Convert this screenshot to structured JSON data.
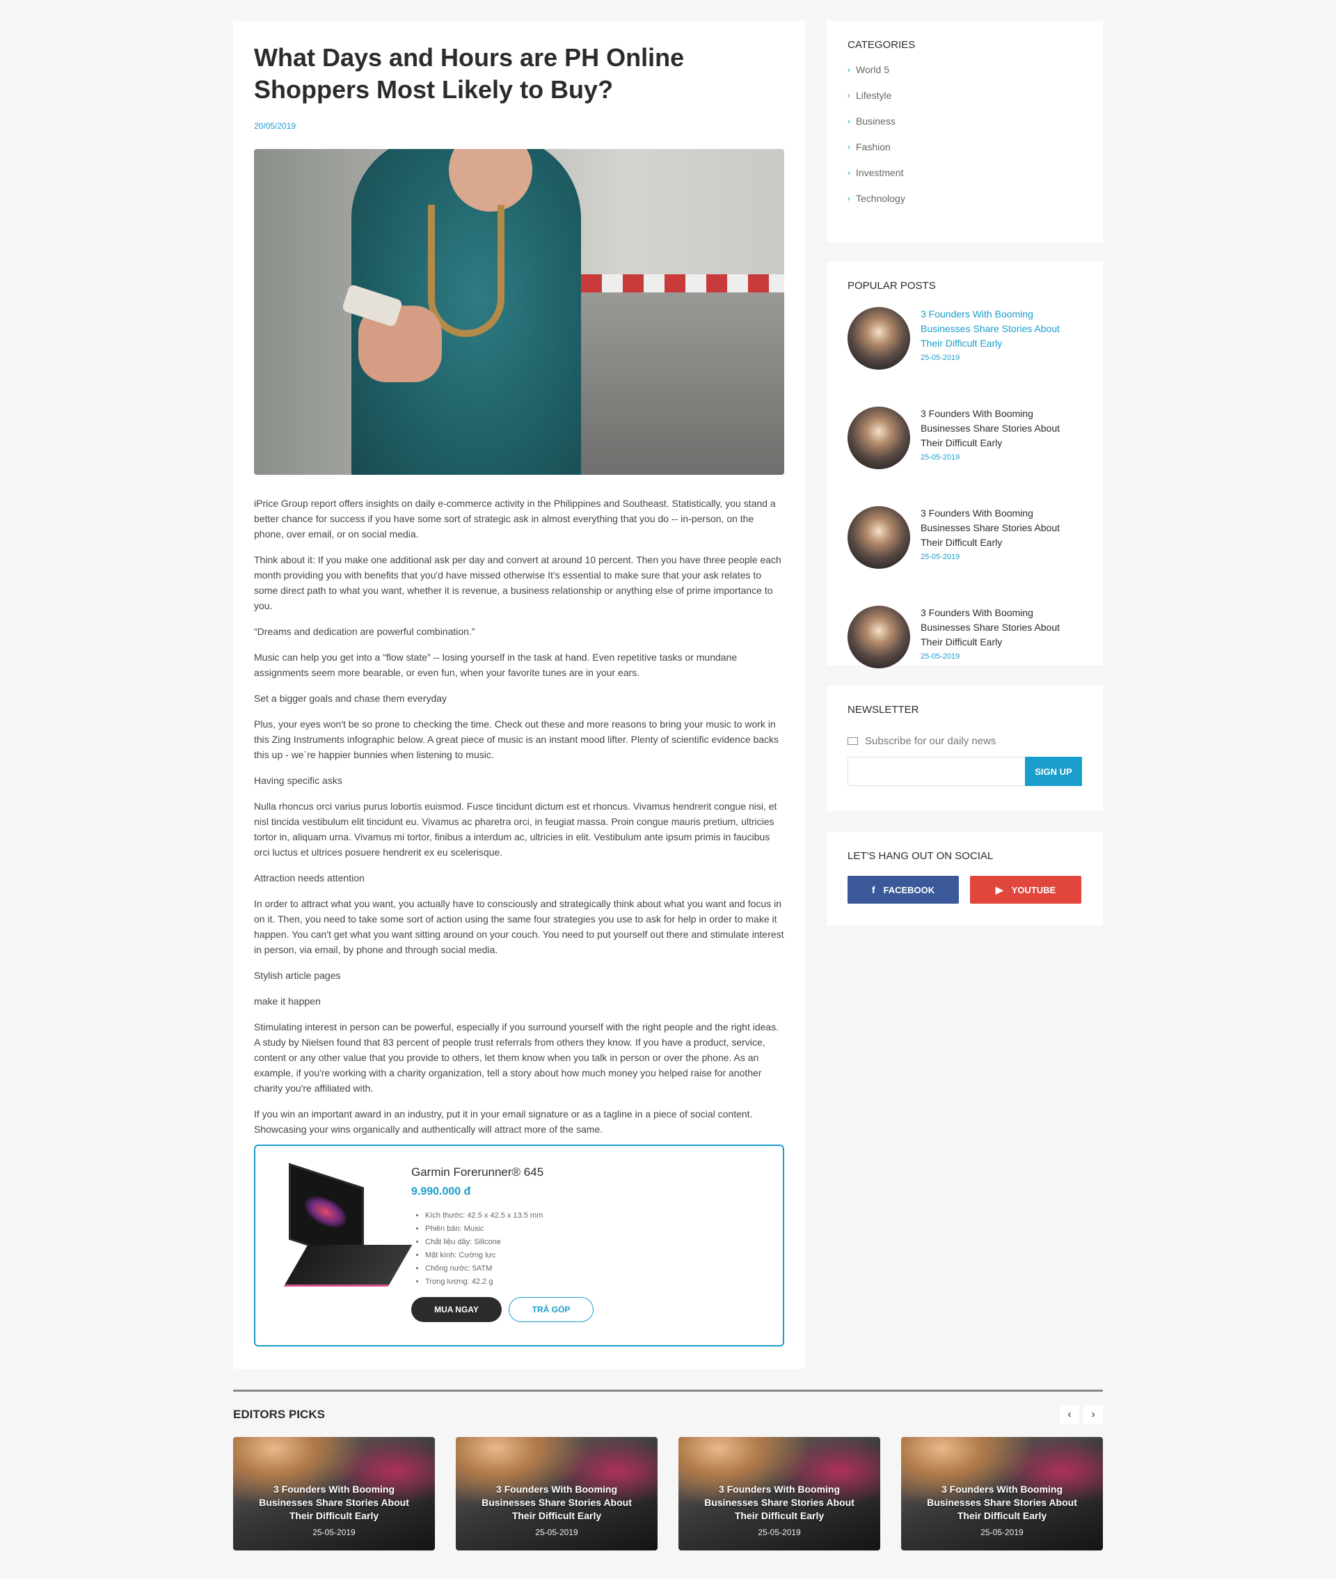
{
  "article": {
    "title": "What Days and Hours are PH Online Shoppers Most Likely to Buy?",
    "date": "20/05/2019",
    "paragraphs": [
      "iPrice Group report offers insights on daily e-commerce activity in the Philippines and Southeast. Statistically, you stand a better chance for success if you have some sort of strategic ask in almost everything that you do -- in-person, on the phone, over email, or on social media.",
      "Think about it: If you make one additional ask per day and convert at around 10 percent. Then you have three people each month providing you with benefits that you'd have missed otherwise It's essential to make sure that your ask relates to some direct path to what you want, whether it is revenue, a business relationship or anything else of prime importance to you.",
      "“Dreams and dedication are powerful combination.”",
      "Music can help you get into a “flow state” -- losing yourself in the task at hand. Even repetitive tasks or mundane assignments seem more bearable, or even fun, when your favorite tunes are in your ears.",
      "Set a bigger goals and chase them everyday",
      "Plus, your eyes won't be so prone to checking the time. Check out these and more reasons to bring your music to work in this Zing Instruments infographic below. A great piece of music is an instant mood lifter. Plenty of scientific evidence backs this up - we`re happier bunnies when listening to music.",
      "Having specific asks",
      "Nulla rhoncus orci varius purus lobortis euismod. Fusce tincidunt dictum est et rhoncus. Vivamus hendrerit congue nisi, et nisl tincida vestibulum elit tincidunt eu. Vivamus ac pharetra orci, in feugiat massa. Proin congue mauris pretium, ultricies tortor in, aliquam urna. Vivamus mi tortor, finibus a interdum ac, ultricies in elit. Vestibulum ante ipsum primis in faucibus orci luctus et ultrices posuere hendrerit ex eu scelerisque.",
      "Attraction needs attention",
      "In order to attract what you want, you actually have to consciously and strategically think about what you want and focus in on it. Then, you need to take some sort of action using the same four strategies you use to ask for help in order to make it happen. You can't get what you want sitting around on your couch. You need to put yourself out there and stimulate interest in person, via email, by phone and through social media.",
      "Stylish article pages",
      "make it happen",
      "Stimulating interest in person can be powerful, especially if you surround yourself with the right people and the right ideas. A study by Nielsen found that 83 percent of people trust referrals from others they know. If you have a product, service, content or any other value that you provide to others, let them know when you talk in person or over the phone. As an example, if you're working with a charity organization, tell a story about how much money you helped raise for another charity you're affiliated with.",
      "If you win an important award in an industry, put it in your email signature or as a tagline in a piece of social content. Showcasing your wins organically and authentically will attract more of the same."
    ]
  },
  "product": {
    "name": "Garmin Forerunner® 645",
    "price": "9.990.000 đ",
    "specs": [
      "Kích thước: 42.5 x 42.5 x 13.5 mm",
      "Phiên bản: Music",
      "Chất liệu dây: Silicone",
      "Mặt kính: Cường lực",
      "Chống nước: 5ATM",
      "Trọng lượng: 42.2 g"
    ],
    "buy_label": "MUA NGAY",
    "installment_label": "TRẢ GÓP"
  },
  "categories": {
    "title": "CATEGORIES",
    "items": [
      "World 5",
      "Lifestyle",
      "Business",
      "Fashion",
      "Investment",
      "Technology"
    ]
  },
  "popular": {
    "title": "POPULAR POSTS",
    "items": [
      {
        "title": "3 Founders With Booming Businesses Share Stories About Their Difficult Early",
        "date": "25-05-2019"
      },
      {
        "title": "3 Founders With Booming Businesses Share Stories About Their Difficult Early",
        "date": "25-05-2019"
      },
      {
        "title": "3 Founders With Booming Businesses Share Stories About Their Difficult Early",
        "date": "25-05-2019"
      },
      {
        "title": "3 Founders With Booming Businesses Share Stories About Their Difficult Early",
        "date": "25-05-2019"
      }
    ]
  },
  "newsletter": {
    "title": "NEWSLETTER",
    "subtitle": "Subscribe for our daily news",
    "placeholder": "",
    "button": "SIGN UP"
  },
  "social": {
    "title": "LET'S HANG OUT ON SOCIAL",
    "facebook": "FACEBOOK",
    "youtube": "YOUTUBE"
  },
  "editors": {
    "title": "EDITORS PICKS",
    "prev": "‹",
    "next": "›",
    "cards": [
      {
        "title": "3 Founders With Booming Businesses Share Stories About Their Difficult Early",
        "date": "25-05-2019"
      },
      {
        "title": "3 Founders With Booming Businesses Share Stories About Their Difficult Early",
        "date": "25-05-2019"
      },
      {
        "title": "3 Founders With Booming Businesses Share Stories About Their Difficult Early",
        "date": "25-05-2019"
      },
      {
        "title": "3 Founders With Booming Businesses Share Stories About Their Difficult Early",
        "date": "25-05-2019"
      }
    ]
  },
  "colors": {
    "accent": "#1a9dcc",
    "facebook": "#3b5998",
    "youtube": "#e1463d",
    "dark": "#2b2b2b"
  }
}
